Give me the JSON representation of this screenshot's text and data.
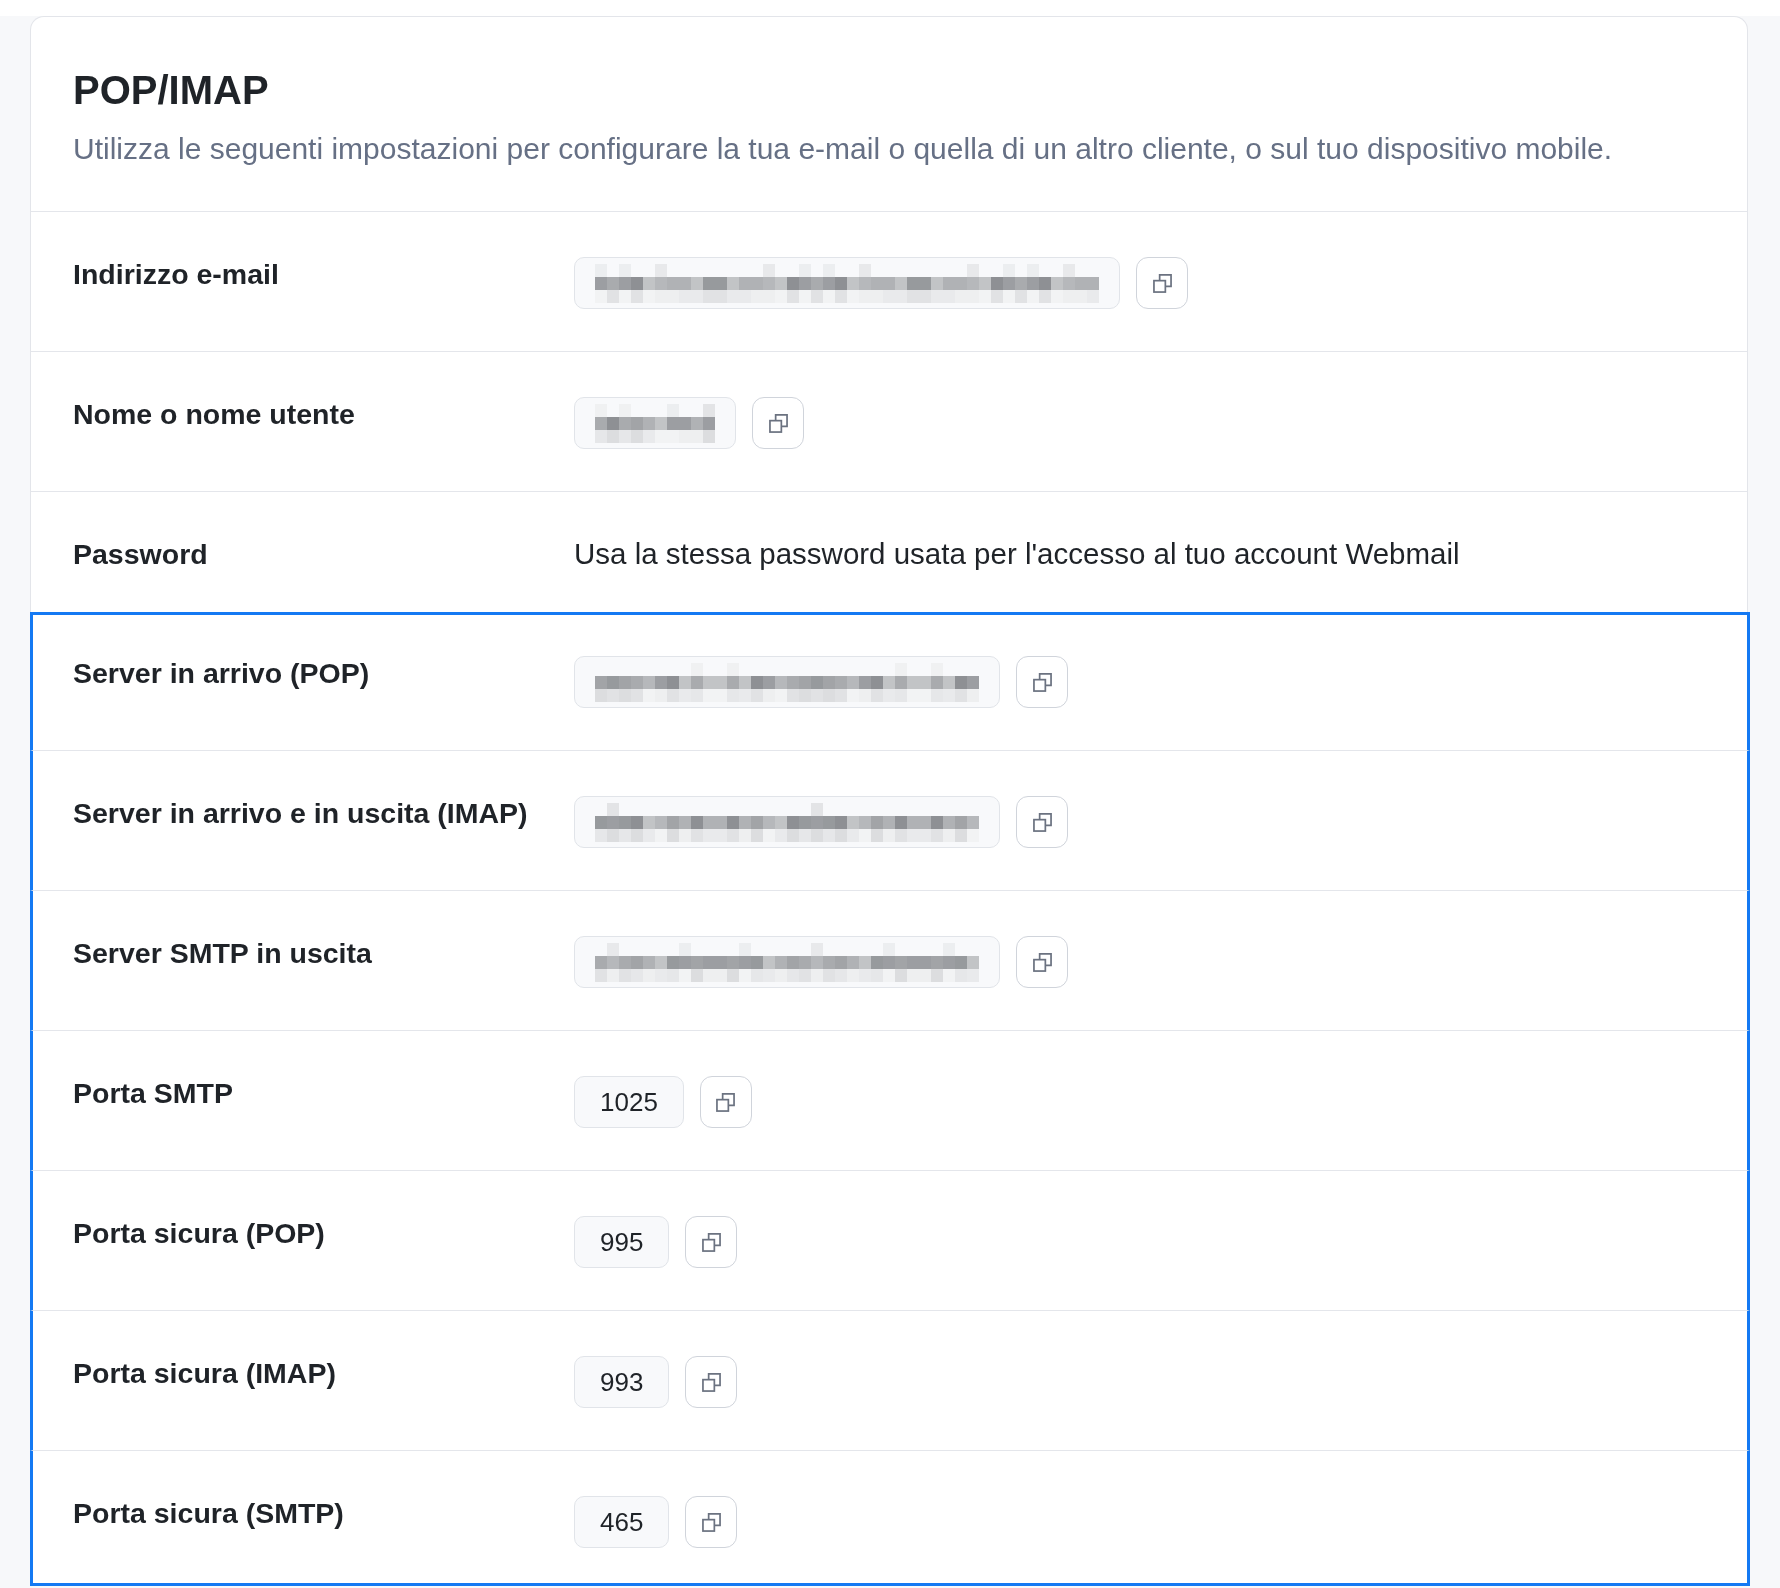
{
  "header": {
    "title": "POP/IMAP",
    "subtitle": "Utilizza le seguenti impostazioni per configurare la tua e-mail o quella di un altro cliente, o sul tuo dispositivo mobile."
  },
  "rows": [
    {
      "label": "Indirizzo e-mail",
      "kind": "email",
      "highlighted": false
    },
    {
      "label": "Nome o nome utente",
      "kind": "username",
      "highlighted": false
    },
    {
      "label": "Password",
      "kind": "note",
      "text": "Usa la stessa password usata per l'accesso al tuo account Webmail",
      "highlighted": false
    },
    {
      "label": "Server in arrivo (POP)",
      "kind": "host",
      "highlighted": true
    },
    {
      "label": "Server in arrivo e in uscita (IMAP)",
      "kind": "host",
      "highlighted": true
    },
    {
      "label": "Server SMTP in uscita",
      "kind": "host",
      "highlighted": true
    },
    {
      "label": "Porta SMTP",
      "kind": "port",
      "value": "1025",
      "highlighted": true
    },
    {
      "label": "Porta sicura (POP)",
      "kind": "port",
      "value": "995",
      "highlighted": true
    },
    {
      "label": "Porta sicura (IMAP)",
      "kind": "port",
      "value": "993",
      "highlighted": true
    },
    {
      "label": "Porta sicura (SMTP)",
      "kind": "port",
      "value": "465",
      "highlighted": true
    }
  ]
}
